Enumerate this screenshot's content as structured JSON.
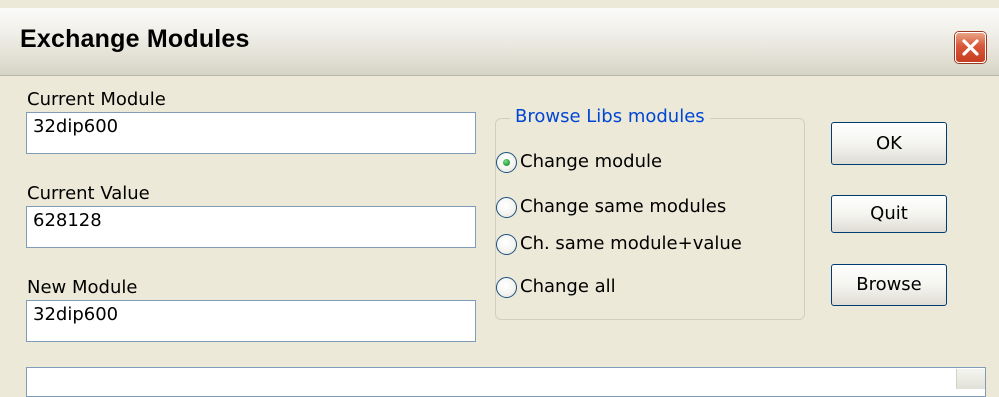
{
  "window": {
    "title": "Exchange Modules",
    "close_icon": "close-icon"
  },
  "fields": {
    "current_module": {
      "label": "Current Module",
      "value": "32dip600"
    },
    "current_value": {
      "label": "Current Value",
      "value": "628128"
    },
    "new_module": {
      "label": "New Module",
      "value": "32dip600"
    }
  },
  "browse_group": {
    "title": "Browse Libs modules",
    "options": [
      {
        "label": "Change module",
        "selected": true
      },
      {
        "label": "Change same modules",
        "selected": false
      },
      {
        "label": "Ch. same module+value",
        "selected": false
      },
      {
        "label": "Change all",
        "selected": false
      }
    ]
  },
  "buttons": {
    "ok": "OK",
    "quit": "Quit",
    "browse": "Browse"
  },
  "colors": {
    "dialog_bg": "#ece9d8",
    "group_title": "#0046d5",
    "field_border": "#7f9db9",
    "close_red": "#d8573a",
    "radio_selected": "#2ba43d"
  }
}
